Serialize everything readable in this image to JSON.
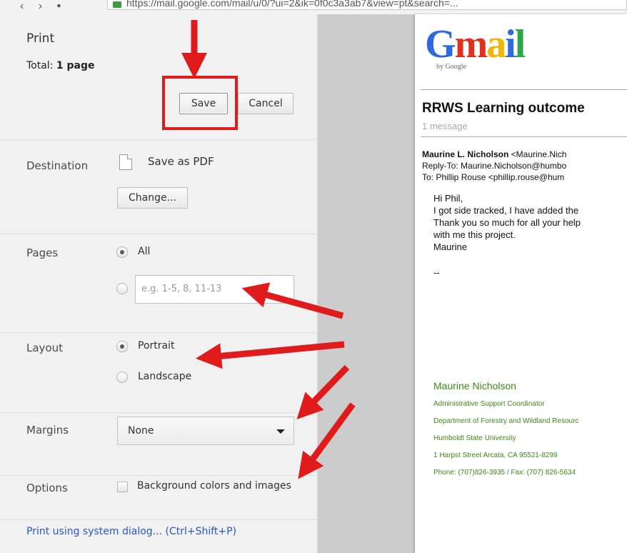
{
  "browser": {
    "url": "https://mail.google.com/mail/u/0/?ui=2&ik=0f0c3a3ab7&view=pt&search=..."
  },
  "print_panel": {
    "title": "Print",
    "total_label": "Total:",
    "total_value": "1 page",
    "save_label": "Save",
    "cancel_label": "Cancel",
    "destination": {
      "label": "Destination",
      "value": "Save as PDF",
      "change_label": "Change..."
    },
    "pages": {
      "label": "Pages",
      "all_label": "All",
      "range_placeholder": "e.g. 1-5, 8, 11-13"
    },
    "layout": {
      "label": "Layout",
      "portrait_label": "Portrait",
      "landscape_label": "Landscape"
    },
    "margins": {
      "label": "Margins",
      "value": "None"
    },
    "options": {
      "label": "Options",
      "background_label": "Background colors and images"
    },
    "system_dialog_link": "Print using system dialog... (Ctrl+Shift+P)"
  },
  "preview": {
    "logo_text": "Gmail",
    "logo_byline": "by Google",
    "subject": "RRWS Learning outcome",
    "message_count": "1 message",
    "from_name": "Maurine L. Nicholson",
    "from_rest": " <Maurine.Nich",
    "reply_to": "Reply-To: Maurine.Nicholson@humbo",
    "to": "To: Phillip Rouse <phillip.rouse@hum",
    "body_lines": [
      "Hi Phil,",
      "I got side tracked, I have added the",
      "Thank you so much for all your help",
      "with me this project.",
      "Maurine"
    ],
    "dashes": "--",
    "signature": {
      "name": "Maurine Nicholson",
      "title": "Administrative Support Coordinator",
      "dept": "Department of Forestry and Wildland Resourc",
      "university": "Humboldt State University",
      "address": "1 Harpst Street Arcata, CA 95521-8299",
      "phone": "Phone: (707)826-3935 / Fax: (707) 826-5634"
    }
  },
  "colors": {
    "annotation_red": "#e01b1b",
    "link_blue": "#2a57c4",
    "signature_green": "#3d8a16"
  }
}
